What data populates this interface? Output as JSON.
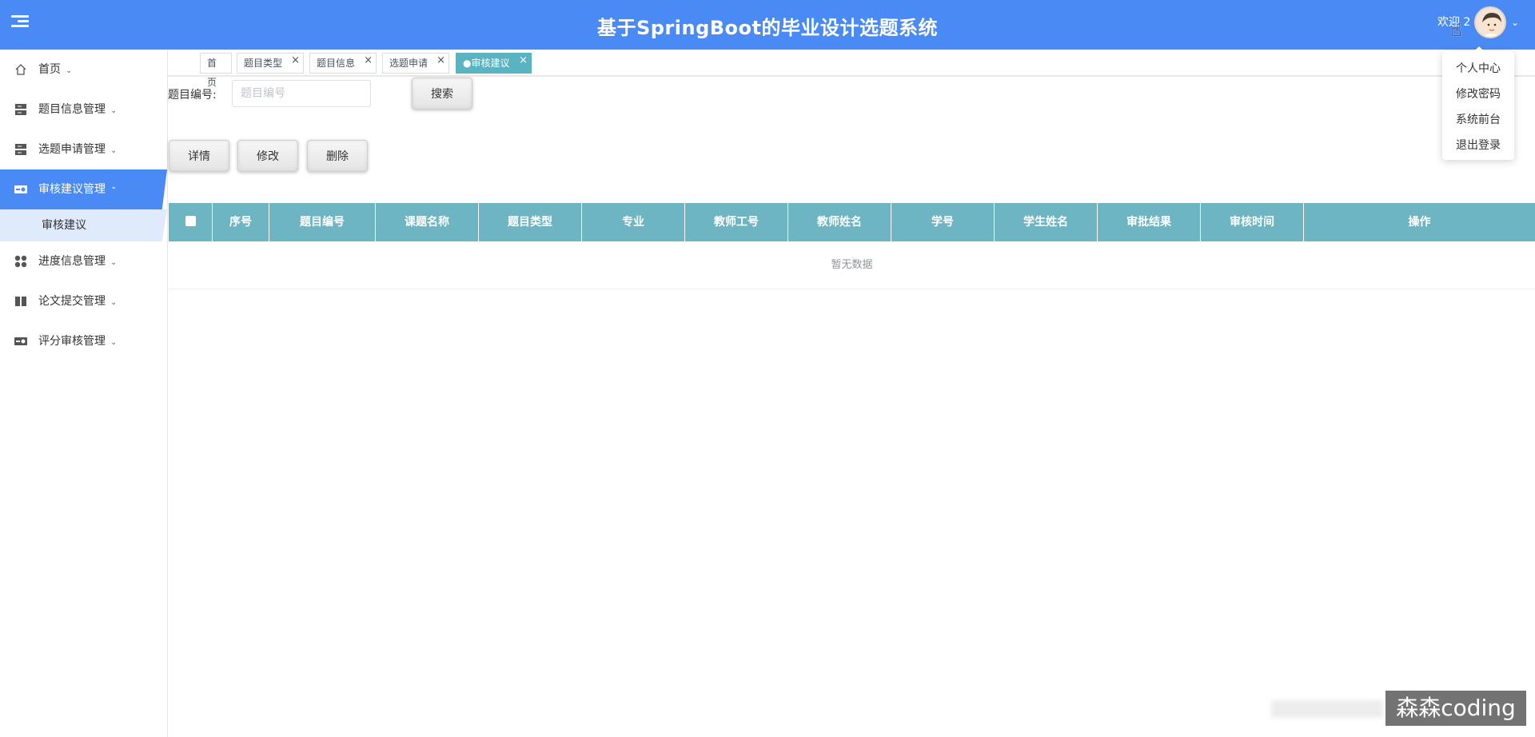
{
  "header": {
    "title": "基于SpringBoot的毕业设计选题系统",
    "welcome": "欢迎 2",
    "caret": "⌄",
    "cursor": "☝"
  },
  "user_menu": {
    "items": [
      "个人中心",
      "修改密码",
      "系统前台",
      "退出登录"
    ]
  },
  "sidebar": {
    "items": [
      {
        "label": "首页",
        "icon": "home-icon"
      },
      {
        "label": "题目信息管理",
        "icon": "server-icon"
      },
      {
        "label": "选题申请管理",
        "icon": "server-icon"
      },
      {
        "label": "审核建议管理",
        "icon": "toggle-icon",
        "active": true
      },
      {
        "label": "进度信息管理",
        "icon": "grid-icon"
      },
      {
        "label": "论文提交管理",
        "icon": "book-icon"
      },
      {
        "label": "评分审核管理",
        "icon": "toggle-icon"
      }
    ],
    "submenu": {
      "label": "审核建议"
    },
    "arrow_down": "⌄",
    "arrow_up": "⌃"
  },
  "tabs": [
    {
      "label": "首页"
    },
    {
      "label": "题目类型"
    },
    {
      "label": "题目信息"
    },
    {
      "label": "选题申请"
    },
    {
      "label": "●审核建议",
      "active": true
    }
  ],
  "tab_close": "×",
  "search": {
    "label": "题目编号:",
    "placeholder": "题目编号",
    "value": "",
    "button": "搜索"
  },
  "actions": {
    "detail": "详情",
    "edit": "修改",
    "delete": "删除"
  },
  "table": {
    "columns": [
      "序号",
      "题目编号",
      "课题名称",
      "题目类型",
      "专业",
      "教师工号",
      "教师姓名",
      "学号",
      "学生姓名",
      "审批结果",
      "审核时间",
      "操作"
    ],
    "empty_text": "暂无数据"
  },
  "watermark": "森森coding",
  "colors": {
    "header": "#4a8af4",
    "table_header": "#6db5c2",
    "active_tab": "#5ab3c0",
    "submenu_bg": "#dfeafd"
  }
}
